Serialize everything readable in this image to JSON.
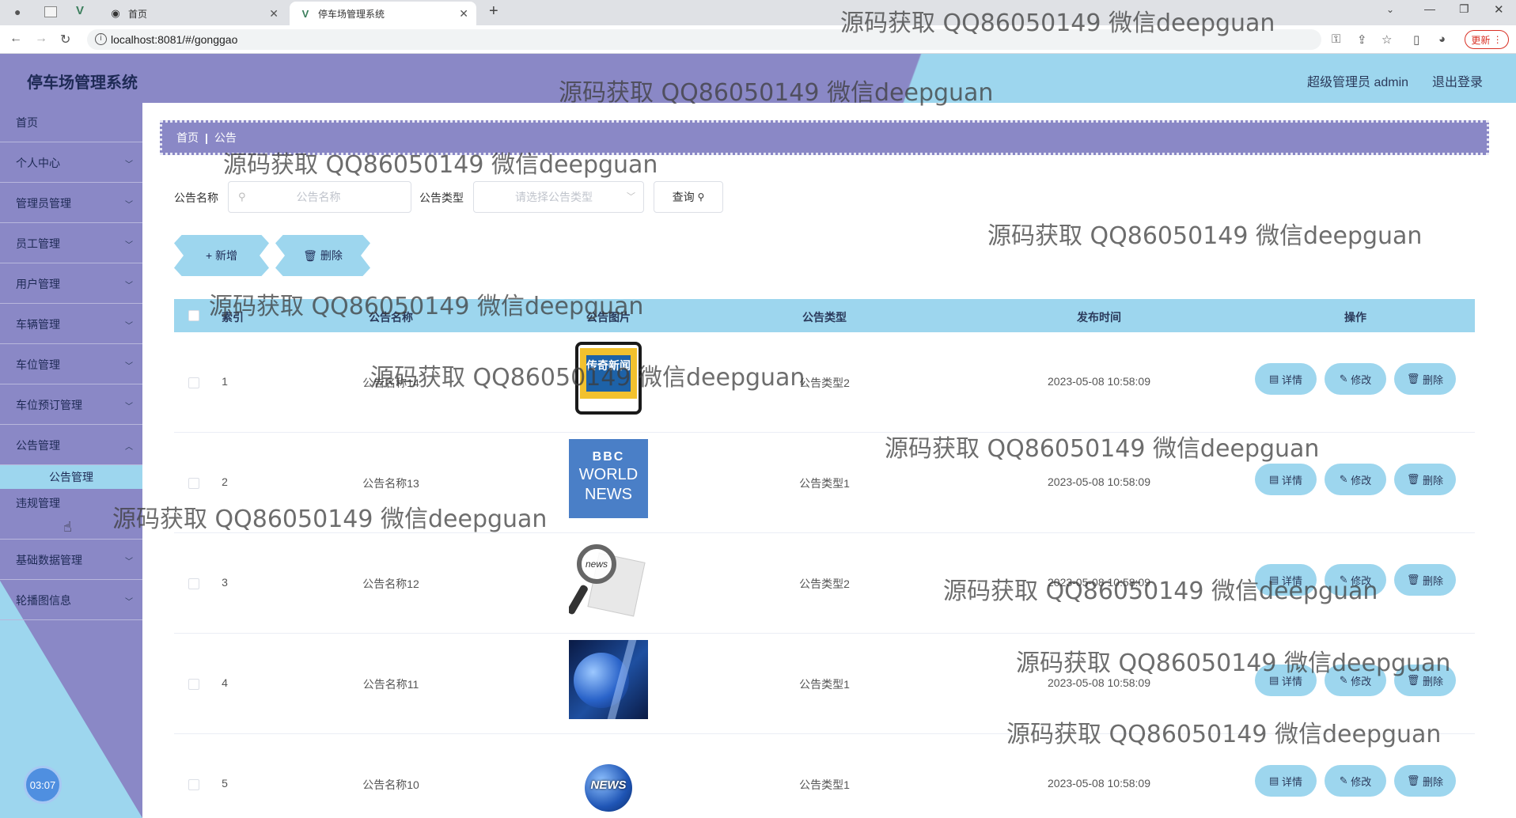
{
  "browser": {
    "tabs": [
      {
        "label": "首页"
      },
      {
        "label": "停车场管理系统"
      }
    ],
    "url": "localhost:8081/#/gonggao",
    "update_label": "更新"
  },
  "header": {
    "title": "停车场管理系统",
    "user": "超级管理员 admin",
    "logout": "退出登录"
  },
  "sidebar": {
    "items": [
      {
        "label": "首页"
      },
      {
        "label": "个人中心"
      },
      {
        "label": "管理员管理"
      },
      {
        "label": "员工管理"
      },
      {
        "label": "用户管理"
      },
      {
        "label": "车辆管理"
      },
      {
        "label": "车位管理"
      },
      {
        "label": "车位预订管理"
      },
      {
        "label": "公告管理"
      },
      {
        "label": "违规管理"
      },
      {
        "label": "基础数据管理"
      },
      {
        "label": "轮播图信息"
      }
    ],
    "submenu": "公告管理",
    "clock": "03:07"
  },
  "breadcrumb": {
    "home": "首页",
    "current": "公告"
  },
  "search": {
    "name_label": "公告名称",
    "name_placeholder": "公告名称",
    "type_label": "公告类型",
    "type_placeholder": "请选择公告类型",
    "query": "查询"
  },
  "actions": {
    "add": "新增",
    "delete": "删除"
  },
  "table": {
    "headers": [
      "索引",
      "公告名称",
      "公告图片",
      "公告类型",
      "发布时间",
      "操作"
    ],
    "rows": [
      {
        "index": "1",
        "name": "公告名称14",
        "type": "公告类型2",
        "time": "2023-05-08 10:58:09"
      },
      {
        "index": "2",
        "name": "公告名称13",
        "type": "公告类型1",
        "time": "2023-05-08 10:58:09"
      },
      {
        "index": "3",
        "name": "公告名称12",
        "type": "公告类型2",
        "time": "2023-05-08 10:58:09"
      },
      {
        "index": "4",
        "name": "公告名称11",
        "type": "公告类型1",
        "time": "2023-05-08 10:58:09"
      },
      {
        "index": "5",
        "name": "公告名称10",
        "type": "公告类型1",
        "time": "2023-05-08 10:58:09"
      }
    ],
    "row_actions": {
      "detail": "详情",
      "edit": "修改",
      "delete": "删除"
    },
    "image_texts": {
      "img1": "传奇新闻",
      "img2a": "BBC",
      "img2b": "WORLD",
      "img2c": "NEWS",
      "img3": "news",
      "img5": "NEWS"
    }
  },
  "watermark": "源码获取 QQ86050149 微信deepguan",
  "colors": {
    "purple": "#8a88c6",
    "lightblue": "#9dd6ee",
    "dark": "#1e2a55"
  }
}
